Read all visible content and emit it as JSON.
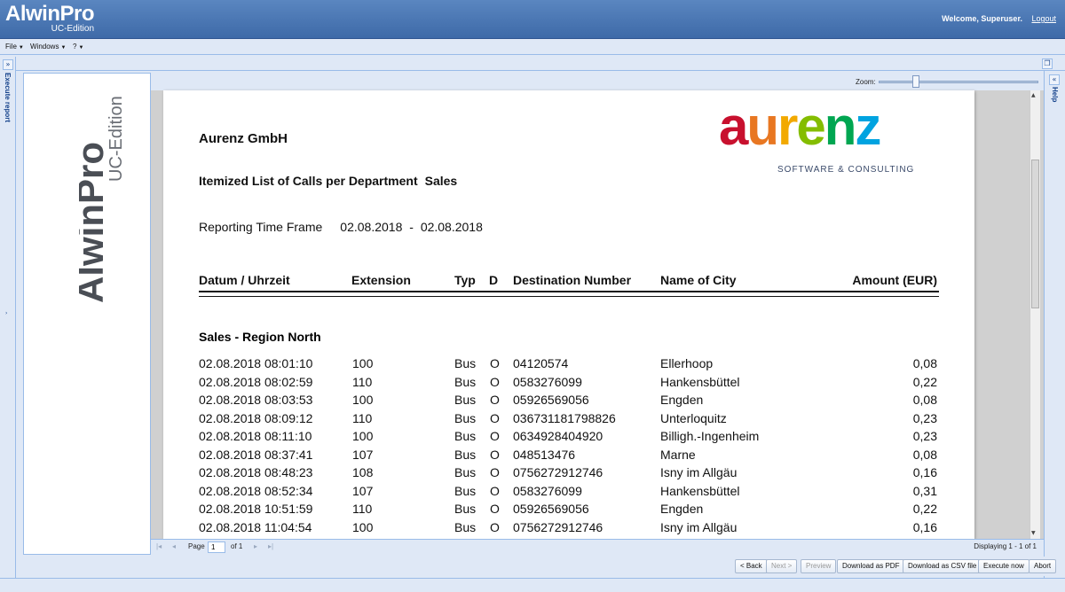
{
  "app": {
    "title": "AlwinPro",
    "subtitle": "UC-Edition"
  },
  "header": {
    "welcome": "Welcome, Superuser.",
    "logout": "Logout"
  },
  "menu": [
    {
      "label": "File"
    },
    {
      "label": "Windows"
    },
    {
      "label": "?"
    }
  ],
  "sidebar": {
    "left_label": "Execute report",
    "right_label": "Help"
  },
  "logo_panel": {
    "title": "AlwinPro",
    "subtitle": "UC-Edition"
  },
  "zoom": {
    "label": "Zoom:",
    "level": 0.22
  },
  "report": {
    "company": "Aurenz GmbH",
    "title": "Itemized List of Calls per Department",
    "department": "Sales",
    "timeframe_label": "Reporting Time Frame",
    "date_from": "02.08.2018",
    "date_sep": "-",
    "date_to": "02.08.2018",
    "logo": {
      "text": "aurenz",
      "tagline": "SOFTWARE & CONSULTING",
      "letter_colors": [
        "#c8102e",
        "#e87722",
        "#f2a900",
        "#84bd00",
        "#00a651",
        "#00a3e0"
      ]
    },
    "columns": {
      "datetime": "Datum / Uhrzeit",
      "extension": "Extension",
      "type": "Typ",
      "direction": "D",
      "destination": "Destination Number",
      "city": "Name of City",
      "amount": "Amount (EUR)"
    },
    "group": "Sales - Region North",
    "rows": [
      {
        "dt": "02.08.2018 08:01:10",
        "ext": "100",
        "type": "Bus",
        "d": "O",
        "num": "04120574",
        "city": "Ellerhoop",
        "amt": "0,08"
      },
      {
        "dt": "02.08.2018 08:02:59",
        "ext": "110",
        "type": "Bus",
        "d": "O",
        "num": "0583276099",
        "city": "Hankensbüttel",
        "amt": "0,22"
      },
      {
        "dt": "02.08.2018 08:03:53",
        "ext": "100",
        "type": "Bus",
        "d": "O",
        "num": "05926569056",
        "city": "Engden",
        "amt": "0,08"
      },
      {
        "dt": "02.08.2018 08:09:12",
        "ext": "110",
        "type": "Bus",
        "d": "O",
        "num": "036731181798826",
        "city": "Unterloquitz",
        "amt": "0,23"
      },
      {
        "dt": "02.08.2018 08:11:10",
        "ext": "100",
        "type": "Bus",
        "d": "O",
        "num": "0634928404920",
        "city": "Billigh.-Ingenheim",
        "amt": "0,23"
      },
      {
        "dt": "02.08.2018 08:37:41",
        "ext": "107",
        "type": "Bus",
        "d": "O",
        "num": "048513476",
        "city": "Marne",
        "amt": "0,08"
      },
      {
        "dt": "02.08.2018 08:48:23",
        "ext": "108",
        "type": "Bus",
        "d": "O",
        "num": "0756272912746",
        "city": "Isny im Allgäu",
        "amt": "0,16"
      },
      {
        "dt": "02.08.2018 08:52:34",
        "ext": "107",
        "type": "Bus",
        "d": "O",
        "num": "0583276099",
        "city": "Hankensbüttel",
        "amt": "0,31"
      },
      {
        "dt": "02.08.2018 10:51:59",
        "ext": "110",
        "type": "Bus",
        "d": "O",
        "num": "05926569056",
        "city": "Engden",
        "amt": "0,22"
      },
      {
        "dt": "02.08.2018 11:04:54",
        "ext": "100",
        "type": "Bus",
        "d": "O",
        "num": "0756272912746",
        "city": "Isny im Allgäu",
        "amt": "0,16"
      }
    ]
  },
  "pager": {
    "page_label": "Page",
    "page_value": "1",
    "of_label": "of 1",
    "displaying": "Displaying 1 - 1 of 1"
  },
  "buttons": {
    "back": "< Back",
    "next": "Next >",
    "preview": "Preview",
    "pdf": "Download as PDF",
    "csv": "Download as CSV file",
    "execute": "Execute now",
    "abort": "Abort"
  }
}
